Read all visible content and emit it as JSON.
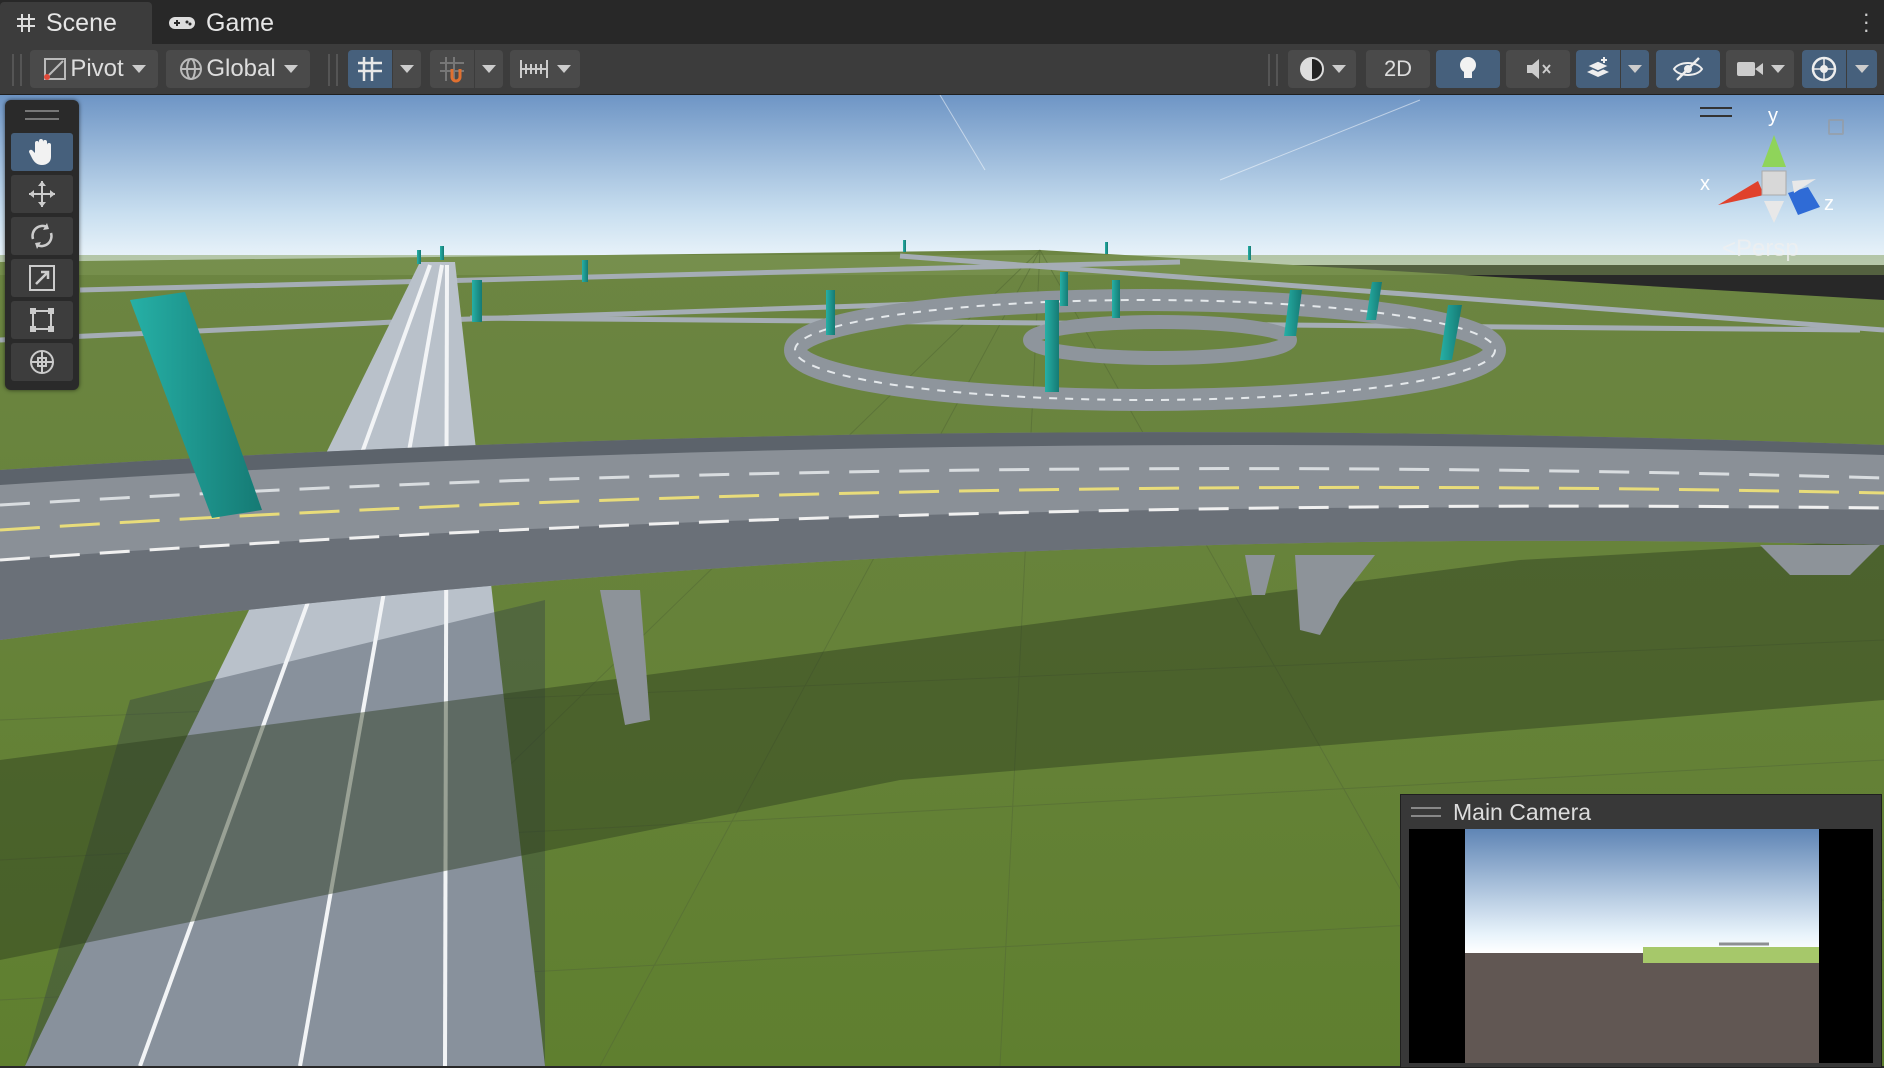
{
  "tabs": [
    {
      "label": "Scene",
      "icon": "scene-grid-icon",
      "active": true
    },
    {
      "label": "Game",
      "icon": "gamepad-icon",
      "active": false
    }
  ],
  "toolbar": {
    "pivot_label": "Pivot",
    "global_label": "Global",
    "mode_2d_label": "2D"
  },
  "gizmo": {
    "y_label": "y",
    "x_label": "x",
    "z_label": "z",
    "projection_label": "Persp"
  },
  "tools": [
    "hand-tool",
    "move-tool",
    "rotate-tool",
    "scale-tool",
    "rect-tool",
    "transform-tool"
  ],
  "camera_preview": {
    "title": "Main Camera"
  },
  "colors": {
    "panel_bg": "#282828",
    "toolbar_bg": "#3c3c3c",
    "active_blue": "#46607c",
    "ground_green": "#6e8a3c",
    "sky_blue": "#6d95c6",
    "pillar_teal": "#1f9c96"
  }
}
